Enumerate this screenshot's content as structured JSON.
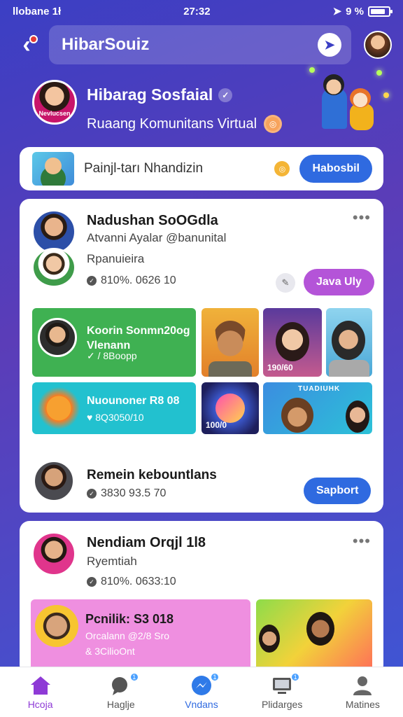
{
  "status_bar": {
    "carrier": "llobane 1ł",
    "time": "27:32",
    "signal": "9 %"
  },
  "header": {
    "title": "HibarSouiz"
  },
  "hero": {
    "avatar_tag": "Nevlucsen",
    "title": "Hibarag Sosfaial",
    "subtitle": "Ruaang Komunitans Virtual"
  },
  "search": {
    "text": "Painjl-tarı Nhandizin",
    "button": "Habosbil"
  },
  "post1": {
    "name": "Nadushan SoOGdla",
    "handle": "Atvanni Ayalar @banunital",
    "meta": "Rpanuieira",
    "stat": "810%. 0626 10",
    "action": "Java Uly",
    "tiles": {
      "green_title": "Koorin Sonmn20og Vlenann",
      "green_sub": "✓ / 8Boopp",
      "teal_title": "Nuounoner R8 08",
      "teal_sub": "♥ 8Q3050/10",
      "photo_badge_1": "190/60",
      "photo_badge_2": "100/0",
      "banner_text": "TUADIUHK"
    },
    "footer_name": "Remein kebountlans",
    "footer_stat": "3830 93.5 70",
    "footer_action": "Sapbort"
  },
  "post2": {
    "name": "Nendiam Orqjl 1l8",
    "meta": "Ryemtiah",
    "stat": "810%. 0633:10",
    "tile_title": "Pcnilik: S3 018",
    "tile_sub1": "Orcalann @2/8 Sro",
    "tile_sub2": "& 3CilioOnt"
  },
  "nav": {
    "items": [
      {
        "label": "Hcoja"
      },
      {
        "label": "Haglje"
      },
      {
        "label": "Vndans"
      },
      {
        "label": "Plidarges"
      },
      {
        "label": "Matines"
      }
    ]
  },
  "colors": {
    "primary": "#2f6ae0",
    "accent": "#b454d8",
    "active_nav": "#8e3ad6"
  }
}
